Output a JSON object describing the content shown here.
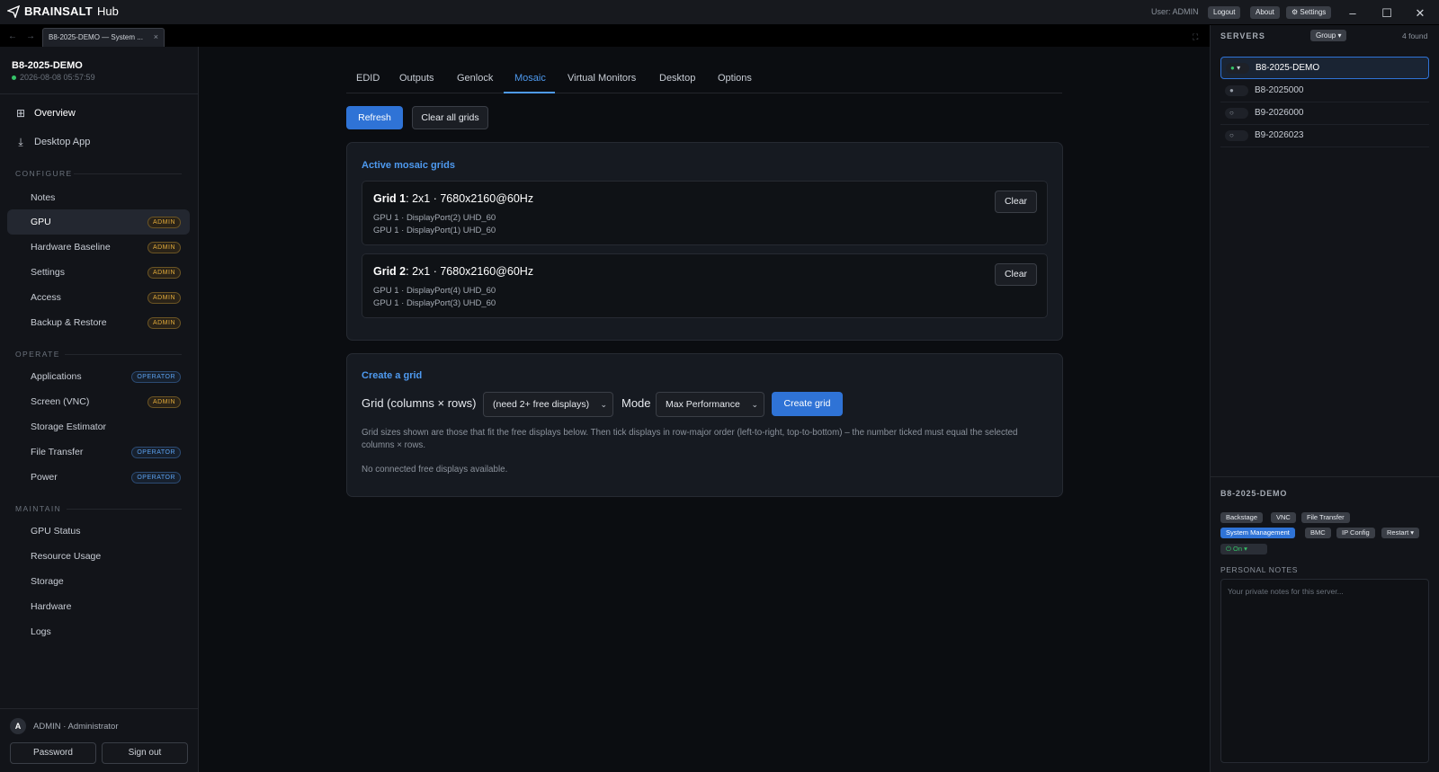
{
  "titlebar": {
    "brand": "BRAINSALT",
    "app": "Hub",
    "user": "User: ADMIN",
    "logout": "Logout",
    "about": "About",
    "settings": "⚙ Settings"
  },
  "browser": {
    "tab_title": "B8-2025-DEMO — System ...",
    "close": "×"
  },
  "sidebar": {
    "server_name": "B8-2025-DEMO",
    "server_time": "2026-08-08 05:57:59",
    "overview": "Overview",
    "desktop_app": "Desktop App",
    "sections": {
      "configure": "CONFIGURE",
      "operate": "OPERATE",
      "maintain": "MAINTAIN"
    },
    "configure": [
      {
        "label": "Notes",
        "badge": ""
      },
      {
        "label": "GPU",
        "badge": "ADMIN"
      },
      {
        "label": "Hardware Baseline",
        "badge": "ADMIN"
      },
      {
        "label": "Settings",
        "badge": "ADMIN"
      },
      {
        "label": "Access",
        "badge": "ADMIN"
      },
      {
        "label": "Backup & Restore",
        "badge": "ADMIN"
      }
    ],
    "operate": [
      {
        "label": "Applications",
        "badge": "OPERATOR"
      },
      {
        "label": "Screen (VNC)",
        "badge": "ADMIN"
      },
      {
        "label": "Storage Estimator",
        "badge": ""
      },
      {
        "label": "File Transfer",
        "badge": "OPERATOR"
      },
      {
        "label": "Power",
        "badge": "OPERATOR"
      }
    ],
    "maintain": [
      {
        "label": "GPU Status"
      },
      {
        "label": "Resource Usage"
      },
      {
        "label": "Storage"
      },
      {
        "label": "Hardware"
      },
      {
        "label": "Logs"
      }
    ],
    "user_initial": "A",
    "user_label": "ADMIN · Administrator",
    "password_btn": "Password",
    "signout_btn": "Sign out"
  },
  "main": {
    "tabs": [
      "EDID",
      "Outputs",
      "Genlock",
      "Mosaic",
      "Virtual Monitors",
      "Desktop",
      "Options"
    ],
    "active_tab": "Mosaic",
    "refresh": "Refresh",
    "clear_all": "Clear all grids",
    "active_title": "Active mosaic grids",
    "grids": [
      {
        "name": "Grid 1",
        "spec": ": 2x1 · 7680x2160@60Hz",
        "lines": [
          "GPU 1 · DisplayPort(2) UHD_60",
          "GPU 1 · DisplayPort(1) UHD_60"
        ],
        "clear": "Clear"
      },
      {
        "name": "Grid 2",
        "spec": ": 2x1 · 7680x2160@60Hz",
        "lines": [
          "GPU 1 · DisplayPort(4) UHD_60",
          "GPU 1 · DisplayPort(3) UHD_60"
        ],
        "clear": "Clear"
      }
    ],
    "create_title": "Create a grid",
    "grid_label": "Grid (columns × rows)",
    "grid_select": "(need 2+ free displays)",
    "mode_label": "Mode",
    "mode_select": "Max Performance",
    "create_btn": "Create grid",
    "help_text": "Grid sizes shown are those that fit the free displays below. Then tick displays in row-major order (left-to-right, top-to-bottom) – the number ticked must equal the selected columns × rows.",
    "no_displays": "No connected free displays available."
  },
  "rpanel": {
    "title": "SERVERS",
    "group": "Group ▾",
    "found": "4 found",
    "servers": [
      {
        "name": "B8-2025-DEMO",
        "status": "online"
      },
      {
        "name": "B8-2025000",
        "status": "idle"
      },
      {
        "name": "B9-2026000",
        "status": "offline"
      },
      {
        "name": "B9-2026023",
        "status": "offline"
      }
    ],
    "selected_title": "B8-2025-DEMO",
    "chips_row1": [
      "Backstage",
      "VNC",
      "File Transfer"
    ],
    "chips_row2": [
      "System Management",
      "BMC",
      "IP Config",
      "Restart ▾"
    ],
    "power_chip": "⏻ On ▾",
    "notes_label": "PERSONAL NOTES",
    "notes_placeholder": "Your private notes for this server..."
  },
  "colors": {
    "accent": "#2f73d6",
    "link": "#4e9af0",
    "online": "#35c468",
    "admin_badge": "#e0a93a",
    "operator_badge": "#5aa0ef"
  }
}
